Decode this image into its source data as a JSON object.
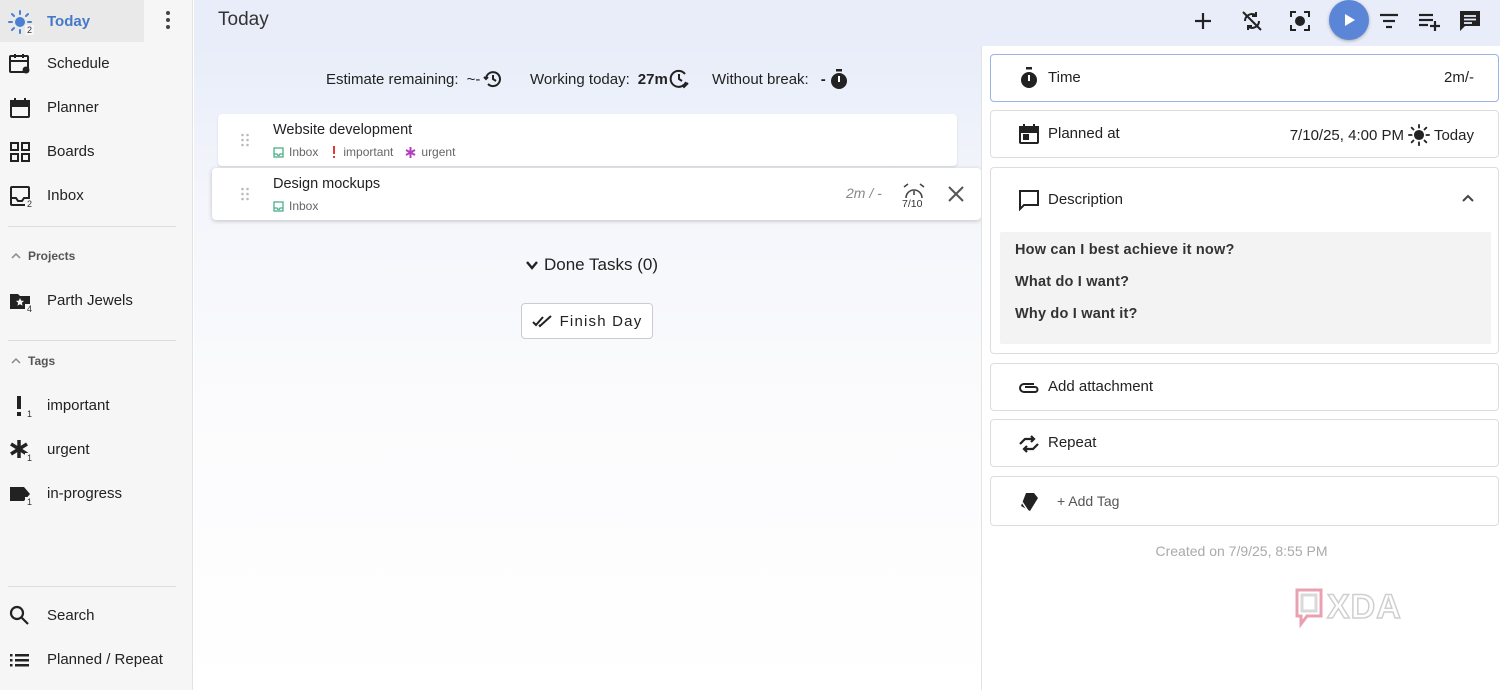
{
  "sidebar": {
    "nav": [
      {
        "label": "Today",
        "badge": "2",
        "icon": "sun-icon"
      },
      {
        "label": "Schedule",
        "icon": "schedule-icon"
      },
      {
        "label": "Planner",
        "icon": "calendar-icon"
      },
      {
        "label": "Boards",
        "icon": "grid-icon"
      },
      {
        "label": "Inbox",
        "badge": "2",
        "icon": "inbox-icon"
      }
    ],
    "projects_heading": "Projects",
    "projects": [
      {
        "label": "Parth Jewels",
        "badge": "4",
        "icon": "folder-star-icon"
      }
    ],
    "tags_heading": "Tags",
    "tags": [
      {
        "label": "important",
        "badge": "1",
        "icon": "exclamation-icon"
      },
      {
        "label": "urgent",
        "badge": "1",
        "icon": "asterisk-icon"
      },
      {
        "label": "in-progress",
        "badge": "1",
        "icon": "label-icon"
      }
    ],
    "bottom": [
      {
        "label": "Search",
        "icon": "search-icon"
      },
      {
        "label": "Planned / Repeat",
        "icon": "list-icon"
      }
    ]
  },
  "header": {
    "title": "Today",
    "actions": [
      "add-icon",
      "sync-disabled-icon",
      "focus-icon",
      "play-icon",
      "filter-icon",
      "playlist-add-icon",
      "comment-icon"
    ],
    "accent": "#5b86d8"
  },
  "stats": {
    "estimate_label": "Estimate remaining:",
    "estimate_value": "~-",
    "working_label": "Working today:",
    "working_value": "27m",
    "break_label": "Without break:",
    "break_value": "-"
  },
  "tasks": [
    {
      "title": "Website development",
      "project": "Inbox",
      "tags": [
        "important",
        "urgent"
      ]
    },
    {
      "title": "Design mockups",
      "project": "Inbox",
      "time": "2m / -",
      "due": "7/10"
    }
  ],
  "done_toggle": "Done Tasks (0)",
  "finish_day": "Finish Day",
  "detail": {
    "time_label": "Time",
    "time_value": "2m/-",
    "planned_label": "Planned at",
    "planned_value": "7/10/25, 4:00 PM",
    "planned_today": "Today",
    "description_label": "Description",
    "questions": [
      "How can I best achieve it now?",
      "What do I want?",
      "Why do I want it?"
    ],
    "attachment_label": "Add attachment",
    "repeat_label": "Repeat",
    "add_tag_label": "+ Add Tag",
    "created": "Created on 7/9/25, 8:55 PM"
  },
  "colors": {
    "important": "#e53935",
    "urgent": "#b040c0",
    "inbox": "#4caf8a",
    "active_nav": "#4479c8"
  }
}
